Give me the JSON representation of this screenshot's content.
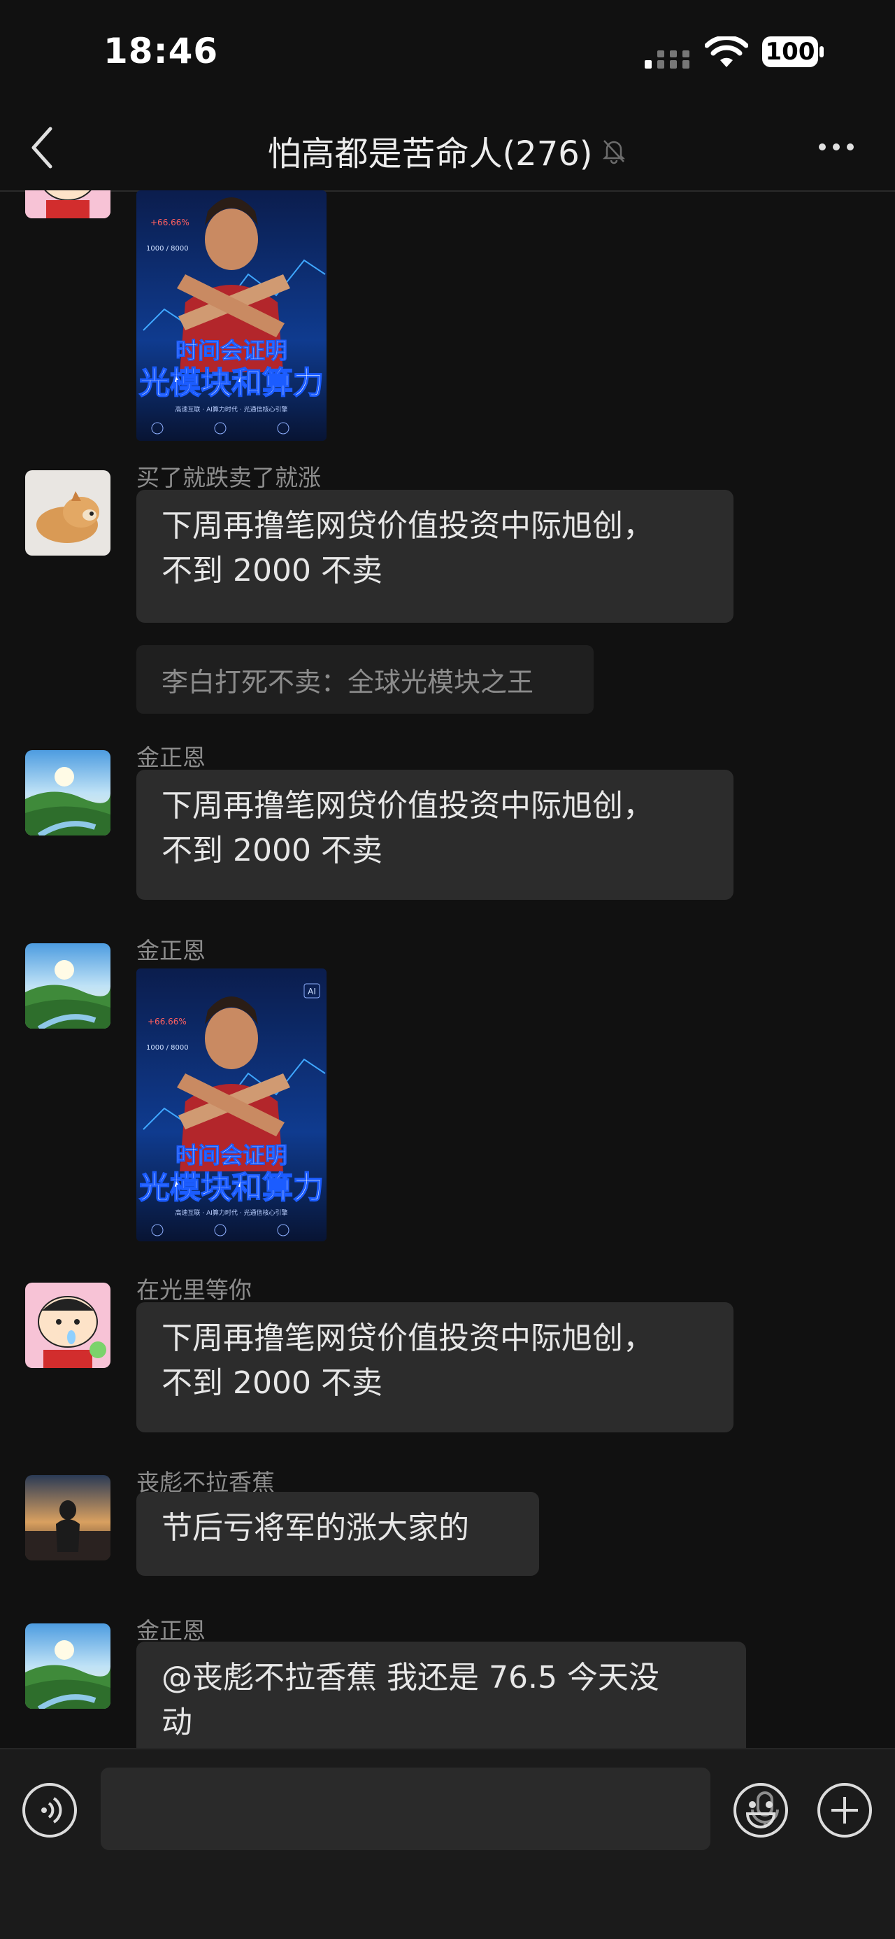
{
  "status_bar": {
    "time": "18:46",
    "battery": "100"
  },
  "header": {
    "title": "怕高都是苦命人(276)"
  },
  "messages": [
    {
      "type": "image"
    },
    {
      "sender": "买了就跌卖了就涨",
      "line1": "下周再撸笔网贷价值投资中际旭创，",
      "line2": "不到 2000 不卖",
      "quote": "李白打死不卖：全球光模块之王"
    },
    {
      "sender": "金正恩",
      "line1": "下周再撸笔网贷价值投资中际旭创，",
      "line2": "不到 2000 不卖"
    },
    {
      "sender": "金正恩",
      "type": "image"
    },
    {
      "sender": "在光里等你",
      "line1": "下周再撸笔网贷价值投资中际旭创，",
      "line2": "不到 2000 不卖"
    },
    {
      "sender": "丧彪不拉香蕉",
      "text": "节后亏将军的涨大家的"
    },
    {
      "sender": "金正恩",
      "line1": "@丧彪不拉香蕉 我还是 76.5  今天没",
      "line2": "动"
    }
  ],
  "poster": {
    "line1": "时间会证明",
    "line2": "光模块和算力",
    "badge": "AI",
    "stat": "+66.66%",
    "small": "1000 / 8000",
    "foot": "高速互联 · AI算力时代 · 光通信核心引擎"
  },
  "colors": {
    "background": "#111111",
    "bubble": "#2c2c2c",
    "quote": "#1f1f1f",
    "input_bar": "#1b1b1b"
  }
}
